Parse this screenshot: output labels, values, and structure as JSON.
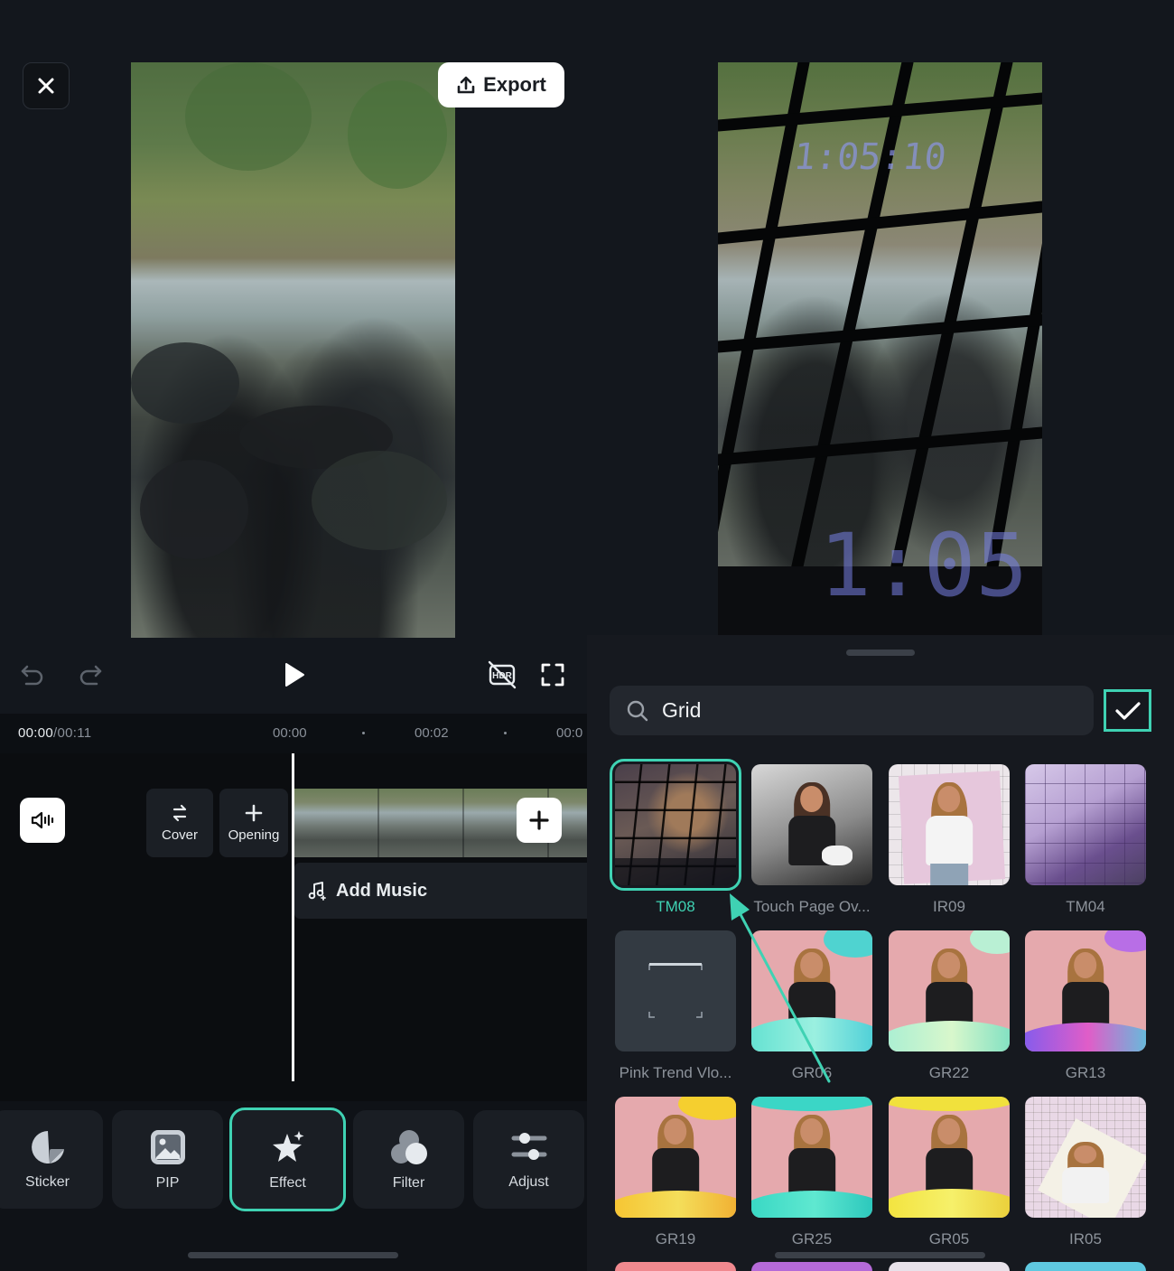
{
  "editor": {
    "export_label": "Export",
    "time_current": "00:00",
    "time_total": "/00:11",
    "ruler_ticks": [
      "00:00",
      "00:02",
      "00:0"
    ],
    "clip_buttons": {
      "cover": "Cover",
      "opening": "Opening"
    },
    "add_music": "Add Music",
    "tools": [
      "Sticker",
      "PIP",
      "Effect",
      "Filter",
      "Adjust"
    ],
    "selected_tool": "Effect",
    "accent": "#3fd2b3"
  },
  "preview_right": {
    "overlay_time_top": "1:05:10",
    "overlay_time_bottom": "1:05"
  },
  "effects_panel": {
    "search_value": "Grid",
    "items": [
      {
        "label": "TM08",
        "selected": true
      },
      {
        "label": "Touch Page Ov..."
      },
      {
        "label": "IR09"
      },
      {
        "label": "TM04"
      },
      {
        "label": "Pink Trend Vlo..."
      },
      {
        "label": "GR06"
      },
      {
        "label": "GR22"
      },
      {
        "label": "GR13"
      },
      {
        "label": "GR19"
      },
      {
        "label": "GR25"
      },
      {
        "label": "GR05"
      },
      {
        "label": "IR05"
      }
    ]
  }
}
